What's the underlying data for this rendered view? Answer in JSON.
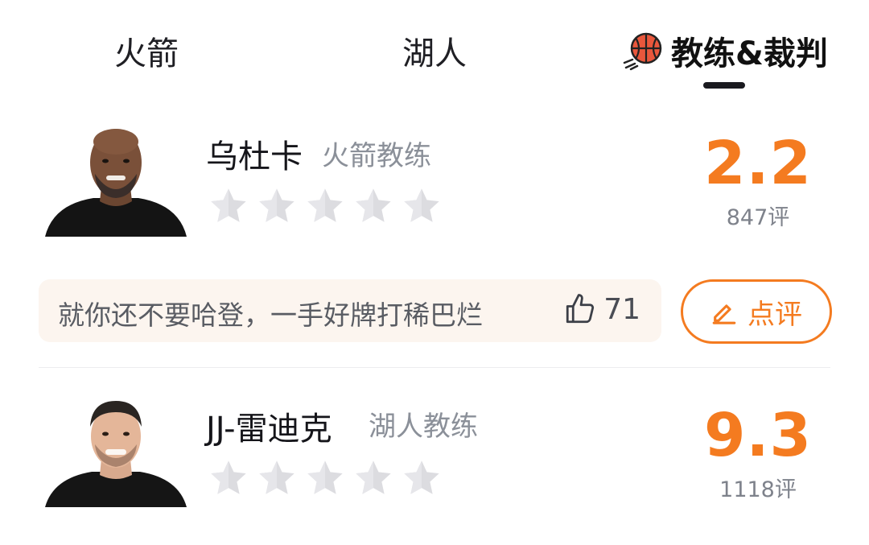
{
  "tabs": [
    {
      "label": "火箭",
      "active": false
    },
    {
      "label": "湖人",
      "active": false
    },
    {
      "label": "教练&裁判",
      "active": true
    }
  ],
  "colors": {
    "accent": "#f47b20",
    "star_empty": "#dcdce0",
    "comment_bg": "#fcf5ef"
  },
  "coaches": [
    {
      "name": "乌杜卡",
      "team": "火箭教练",
      "stars": 0,
      "score": "2.2",
      "count": "847评",
      "avatar_icon": "person-avatar-bald"
    },
    {
      "name": "JJ-雷迪克",
      "team": "湖人教练",
      "stars": 0,
      "score": "9.3",
      "count": "1118评",
      "avatar_icon": "person-avatar-hair"
    }
  ],
  "comment": {
    "text": "就你还不要哈登，一手好牌打稀巴烂",
    "likes": "71",
    "like_icon": "thumbs-up-icon"
  },
  "review_button": {
    "label": "点评",
    "icon": "pencil-icon"
  }
}
